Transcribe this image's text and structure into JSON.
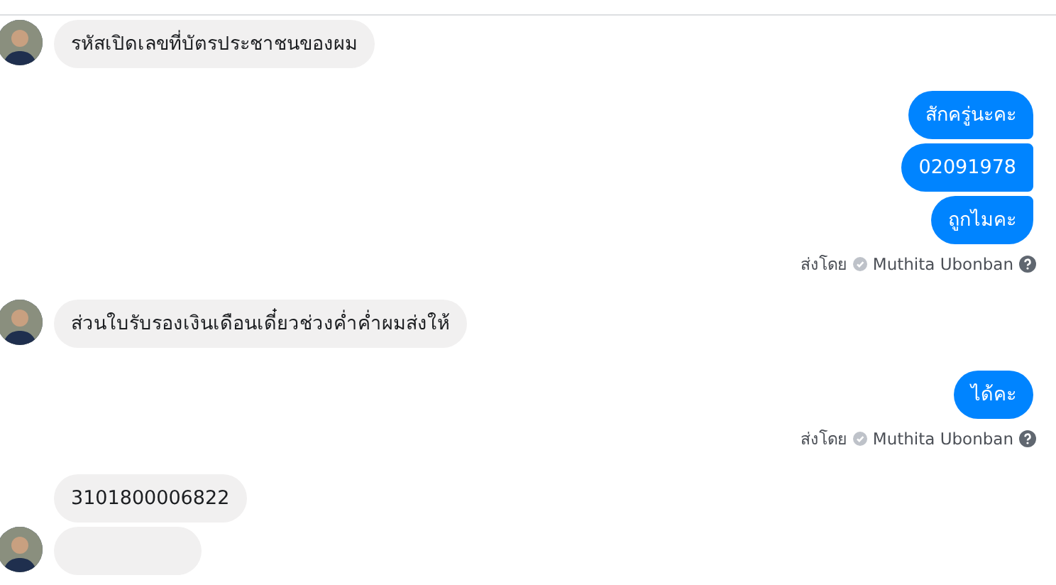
{
  "groups": [
    {
      "kind": "incoming",
      "messages": [
        {
          "text": "รหัสเปิดเลขที่บัตรประชาชนของผม",
          "avatar": true
        }
      ]
    },
    {
      "kind": "outgoing",
      "messages": [
        {
          "text": "สักครู่นะคะ"
        },
        {
          "text": "02091978"
        },
        {
          "text": "ถูกไมคะ"
        }
      ],
      "sent_by": {
        "prefix": "ส่งโดย",
        "name": "Muthita Ubonban"
      }
    },
    {
      "kind": "incoming",
      "messages": [
        {
          "text": "ส่วนใบรับรองเงินเดือนเดี๋ยวช่วงค่ำค่ำผมส่งให้",
          "avatar": true
        }
      ]
    },
    {
      "kind": "outgoing",
      "messages": [
        {
          "text": "ได้คะ"
        }
      ],
      "sent_by": {
        "prefix": "ส่งโดย",
        "name": "Muthita Ubonban"
      }
    },
    {
      "kind": "incoming",
      "messages": [
        {
          "text": "3101800006822",
          "avatar": false
        },
        {
          "avatar": true
        }
      ]
    }
  ]
}
